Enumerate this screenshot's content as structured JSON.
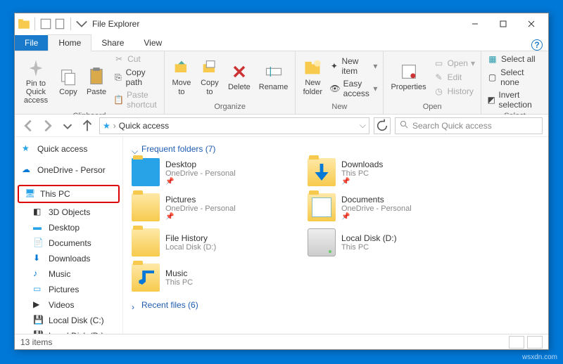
{
  "window": {
    "title": "File Explorer"
  },
  "tabs": {
    "file": "File",
    "home": "Home",
    "share": "Share",
    "view": "View"
  },
  "ribbon": {
    "clipboard": {
      "label": "Clipboard",
      "pin": "Pin to Quick\naccess",
      "copy": "Copy",
      "paste": "Paste",
      "cut": "Cut",
      "copypath": "Copy path",
      "pasteshortcut": "Paste shortcut"
    },
    "organize": {
      "label": "Organize",
      "moveto": "Move\nto",
      "copyto": "Copy\nto",
      "delete": "Delete",
      "rename": "Rename"
    },
    "new": {
      "label": "New",
      "newfolder": "New\nfolder",
      "newitem": "New item",
      "easyaccess": "Easy access"
    },
    "open": {
      "label": "Open",
      "properties": "Properties",
      "open": "Open",
      "edit": "Edit",
      "history": "History"
    },
    "select": {
      "label": "Select",
      "selectall": "Select all",
      "selectnone": "Select none",
      "invert": "Invert selection"
    }
  },
  "address": {
    "location": "Quick access"
  },
  "search": {
    "placeholder": "Search Quick access"
  },
  "nav": {
    "quickaccess": "Quick access",
    "onedrive": "OneDrive - Persor",
    "thispc": "This PC",
    "objects3d": "3D Objects",
    "desktop": "Desktop",
    "documents": "Documents",
    "downloads": "Downloads",
    "music": "Music",
    "pictures": "Pictures",
    "videos": "Videos",
    "diskc": "Local Disk (C:)",
    "diskd": "Local Disk (D:)"
  },
  "sections": {
    "frequent": "Frequent folders (7)",
    "recent": "Recent files (6)"
  },
  "folders": [
    {
      "name": "Desktop",
      "sub": "OneDrive - Personal",
      "pinned": true,
      "icon": "desktop"
    },
    {
      "name": "Downloads",
      "sub": "This PC",
      "pinned": true,
      "icon": "downloads"
    },
    {
      "name": "Pictures",
      "sub": "OneDrive - Personal",
      "pinned": true,
      "icon": "folder"
    },
    {
      "name": "Documents",
      "sub": "OneDrive - Personal",
      "pinned": true,
      "icon": "documents"
    },
    {
      "name": "File History",
      "sub": "Local Disk (D:)",
      "pinned": false,
      "icon": "folder"
    },
    {
      "name": "Local Disk (D:)",
      "sub": "This PC",
      "pinned": false,
      "icon": "drive"
    },
    {
      "name": "Music",
      "sub": "This PC",
      "pinned": false,
      "icon": "music"
    }
  ],
  "status": {
    "count": "13 items"
  },
  "watermark": "wsxdn.com"
}
